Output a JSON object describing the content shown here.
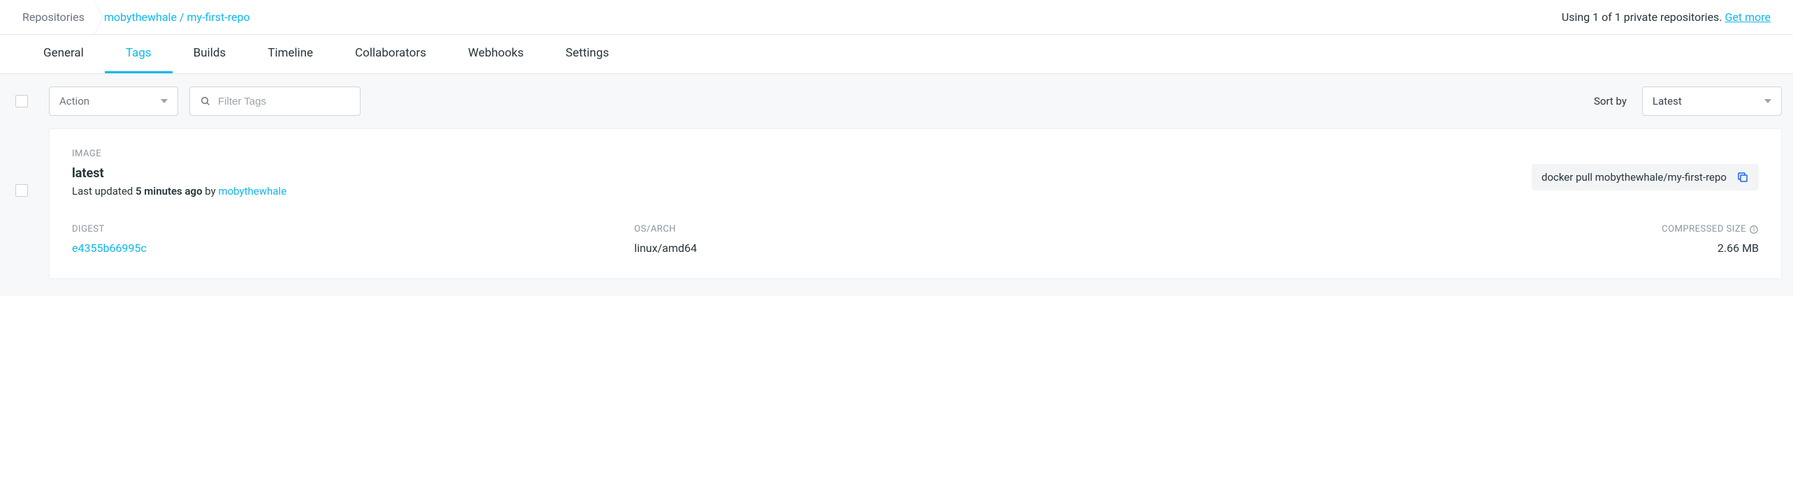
{
  "breadcrumb": {
    "root": "Repositories",
    "owner": "mobythewhale",
    "repo": "my-first-repo",
    "separator": " / "
  },
  "usage": {
    "text": "Using 1 of 1 private repositories. ",
    "link": "Get more"
  },
  "tabs": [
    {
      "label": "General",
      "active": false
    },
    {
      "label": "Tags",
      "active": true
    },
    {
      "label": "Builds",
      "active": false
    },
    {
      "label": "Timeline",
      "active": false
    },
    {
      "label": "Collaborators",
      "active": false
    },
    {
      "label": "Webhooks",
      "active": false
    },
    {
      "label": "Settings",
      "active": false
    }
  ],
  "toolbar": {
    "action_label": "Action",
    "filter_placeholder": "Filter Tags",
    "sort_label": "Sort by",
    "sort_value": "Latest"
  },
  "card": {
    "header_label": "IMAGE",
    "name": "latest",
    "updated_prefix": "Last updated ",
    "updated_time": "5 minutes ago",
    "updated_by": " by ",
    "author": "mobythewhale",
    "pull_command": "docker pull mobythewhale/my-first-repo",
    "digest_label": "DIGEST",
    "digest_value": "e4355b66995c",
    "osarch_label": "OS/ARCH",
    "osarch_value": "linux/amd64",
    "size_label": "COMPRESSED SIZE",
    "size_value": "2.66 MB"
  }
}
